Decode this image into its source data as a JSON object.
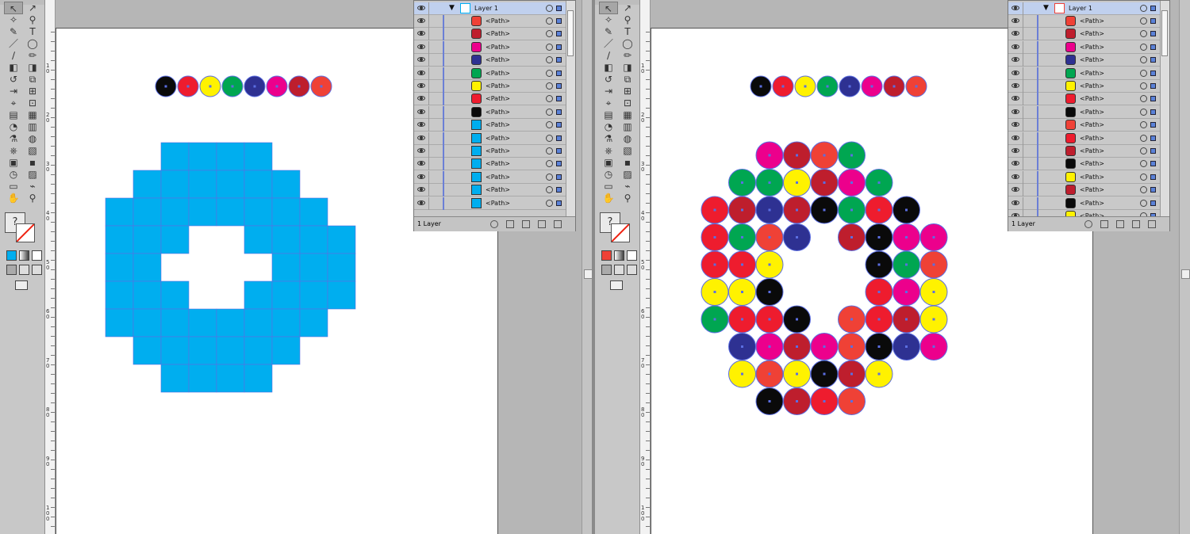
{
  "colors": {
    "black": "#0a0a0a",
    "red": "#ee1c2e",
    "yellow": "#fff200",
    "green": "#00a651",
    "navy": "#2e3192",
    "magenta": "#ec008c",
    "crimson": "#be1e2d",
    "tomato": "#ef4136",
    "blue": "#00aeef",
    "selection": "#5b6ee1"
  },
  "palette_row": [
    "black",
    "red",
    "yellow",
    "green",
    "navy",
    "magenta",
    "crimson",
    "tomato"
  ],
  "left_panel": {
    "layer_name": "Layer 1",
    "path_label": "<Path>",
    "rows": [
      "tomato",
      "crimson",
      "magenta",
      "navy",
      "green",
      "yellow",
      "red",
      "black",
      "blue",
      "blue",
      "blue",
      "blue",
      "blue",
      "blue",
      "blue"
    ],
    "footer": "1 Layer"
  },
  "right_panel": {
    "layer_name": "Layer 1",
    "path_label": "<Path>",
    "rows": [
      "tomato",
      "crimson",
      "magenta",
      "navy",
      "green",
      "yellow",
      "red",
      "black",
      "tomato",
      "red",
      "crimson",
      "black",
      "yellow",
      "crimson",
      "black",
      "yellow"
    ],
    "footer": "1 Layer"
  },
  "blue_grid_rows": [
    "..XXXX..",
    ".XXXXXX.",
    "XXXXXXXX.",
    "XXX..XXXX",
    "XX....XXX",
    "XXX..XXXX",
    "XXXXXXXX.",
    ".XXXXXX.",
    "..XXXX.."
  ],
  "circle_grid": [
    [
      null,
      null,
      "magenta",
      "crimson",
      "tomato",
      "green",
      null,
      null,
      null
    ],
    [
      null,
      "green",
      "green",
      "yellow",
      "crimson",
      "magenta",
      "green",
      null,
      null
    ],
    [
      "red",
      "crimson",
      "navy",
      "crimson",
      "black",
      "green",
      "red",
      "black",
      null
    ],
    [
      "red",
      "green",
      "tomato",
      "navy",
      null,
      "crimson",
      "black",
      "magenta",
      "magenta"
    ],
    [
      "red",
      "red",
      "yellow",
      null,
      null,
      null,
      "black",
      "green",
      "tomato"
    ],
    [
      "yellow",
      "yellow",
      "black",
      null,
      null,
      null,
      "red",
      "magenta",
      "yellow"
    ],
    [
      "green",
      "red",
      "red",
      "black",
      null,
      "tomato",
      "red",
      "crimson",
      "yellow"
    ],
    [
      null,
      "navy",
      "magenta",
      "crimson",
      "magenta",
      "tomato",
      "black",
      "navy",
      "magenta"
    ],
    [
      null,
      "yellow",
      "tomato",
      "yellow",
      "black",
      "crimson",
      "yellow",
      null,
      null
    ],
    [
      null,
      null,
      "black",
      "crimson",
      "red",
      "tomato",
      null,
      null,
      null
    ]
  ],
  "ruler_labels": [
    "1 0",
    "2 0",
    "3 0",
    "4 0",
    "5 0",
    "6 0",
    "7 0",
    "8 0",
    "9 0",
    "1 0 0"
  ],
  "tool_glyphs": [
    "↖",
    "↗",
    "✧",
    "⚲",
    "✎",
    "T",
    "／",
    "◯",
    "∕",
    "✏",
    "◧",
    "◨",
    "↺",
    "⧉",
    "⇥",
    "⊞",
    "⌖",
    "⊡",
    "▤",
    "▦",
    "◔",
    "▥",
    "⚗",
    "◍",
    "⎈",
    "▧",
    "▣",
    "▪",
    "◷",
    "▨",
    "▭",
    "⌁",
    "✋",
    "⚲"
  ],
  "fill_stroke_glyph": "?"
}
